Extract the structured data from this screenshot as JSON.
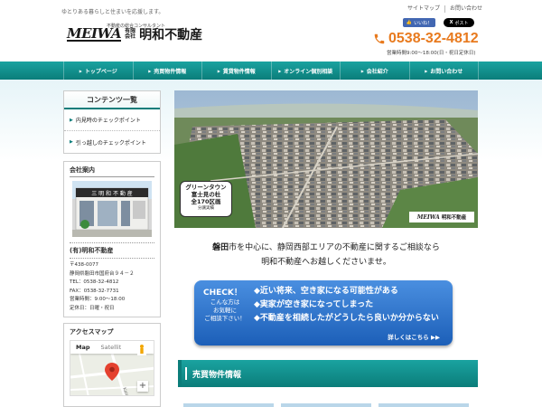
{
  "header": {
    "tagline": "ゆとりある暮らしと住まいを応援します。",
    "logo_mark": "MEIWA",
    "logo_subtitle": "不動産の総合コンサルタント",
    "logo_kind": "有限会社",
    "logo_name": "明和不動産",
    "top_links": [
      "サイトマップ",
      "お問い合わせ"
    ],
    "facebook_label": "いいね！",
    "x_label": "ポスト",
    "phone": "0538-32-4812",
    "hours": "営業時間9:00～18:00(日・祝日定休日)"
  },
  "nav": {
    "items": [
      "トップページ",
      "売買物件情報",
      "賃貸物件情報",
      "オンライン個別相談",
      "会社紹介",
      "お問い合わせ"
    ]
  },
  "sidebar": {
    "contents_title": "コンテンツ一覧",
    "contents_items": [
      "内見時のチェックポイント",
      "引っ越しのチェックポイント"
    ],
    "company_title": "会社案内",
    "company_name": "(有)明和不動産",
    "company_lines": [
      "〒438-0077",
      "静岡県磐田市国府台９４－２",
      "TEL：0538-32-4812",
      "FAX：0538-32-7731",
      "営業時間：9:00～18:00",
      "定休日：日曜・祝日"
    ],
    "access_title": "アクセスマップ",
    "map_tabs": [
      "Map",
      "Satellit"
    ],
    "map_street": "Kaidate"
  },
  "hero": {
    "badge_line1": "グリーンタウン",
    "badge_line2": "富士見の杜",
    "badge_line3": "全170区画",
    "badge_line4": "分譲実績",
    "logo_mark": "MEIWA",
    "logo_name": "明和不動産"
  },
  "main": {
    "intro_line1_highlight": "磐田",
    "intro_line1_rest": "市を中心に、静岡西部エリアの不動産に関するご相談なら",
    "intro_line2": "明和不動産へお越しくださいませ。",
    "check_title": "CHECK！",
    "check_side": [
      "こんな方は",
      "お気軽に",
      "ご相談下さい！"
    ],
    "check_items": [
      "◆近い将来、空き家になる可能性がある",
      "◆実家が空き家になってしまった",
      "◆不動産を相続したがどうしたら良いか分からない"
    ],
    "check_more": "詳しくはこちら ▶▶",
    "section_title": "売買物件情報"
  },
  "colors": {
    "accent_teal": "#0b7d7a",
    "phone_orange": "#e87a1e",
    "check_blue": "#1c5fb8"
  }
}
